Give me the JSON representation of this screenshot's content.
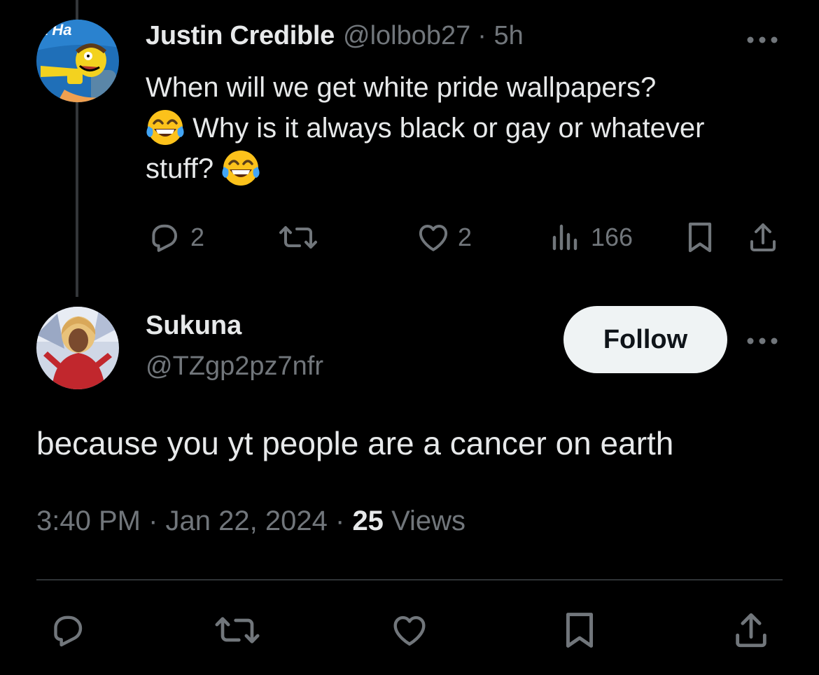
{
  "parent_tweet": {
    "display_name": "Justin Credible",
    "handle": "@lolbob27",
    "time": "· 5h",
    "avatar_caption": "a Ha",
    "text_line1": "When will we get white pride wallpapers?",
    "text_line2": "Why is it always black or gay or whatever",
    "text_line3": "stuff?",
    "emoji": "face-with-tears-of-joy",
    "reply_count": "2",
    "like_count": "2",
    "view_count": "166"
  },
  "reply_tweet": {
    "display_name": "Sukuna",
    "handle": "@TZgp2pz7nfr",
    "follow_label": "Follow",
    "text": "because you yt people are a cancer on earth",
    "time": "3:40 PM",
    "date": "Jan 22, 2024",
    "views_count": "25",
    "views_label": "Views"
  },
  "icons": {
    "reply": "reply-icon",
    "retweet": "retweet-icon",
    "like": "heart-icon",
    "views": "bar-chart-icon",
    "bookmark": "bookmark-icon",
    "share": "share-icon",
    "more": "more-icon"
  },
  "colors": {
    "background": "#000000",
    "primary_text": "#e7e9ea",
    "secondary_text": "#71767b",
    "follow_button_bg": "#eff3f4",
    "divider": "#2f3336"
  }
}
